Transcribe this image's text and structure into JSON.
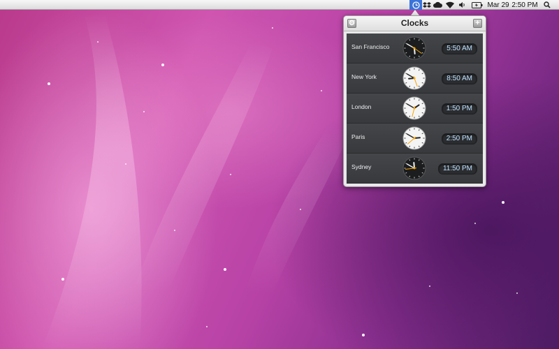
{
  "menubar": {
    "date": "Mar 29",
    "time": "2:50 PM",
    "icons": [
      "clock-icon",
      "dropbox-icon",
      "cloud-icon",
      "wifi-icon",
      "volume-icon",
      "battery-icon",
      "spotlight-search-icon"
    ]
  },
  "popover": {
    "title": "Clocks",
    "gear_label": "⚙",
    "add_label": "+",
    "clocks": [
      {
        "city": "San Francisco",
        "time": "5:50 AM",
        "hour": 5,
        "minute": 50,
        "face": "dark"
      },
      {
        "city": "New York",
        "time": "8:50 AM",
        "hour": 8,
        "minute": 50,
        "face": "light"
      },
      {
        "city": "London",
        "time": "1:50 PM",
        "hour": 1,
        "minute": 50,
        "face": "light"
      },
      {
        "city": "Paris",
        "time": "2:50 PM",
        "hour": 2,
        "minute": 50,
        "face": "light"
      },
      {
        "city": "Sydney",
        "time": "11:50 PM",
        "hour": 11,
        "minute": 50,
        "face": "dark"
      }
    ]
  },
  "colors": {
    "accent": "#3a73d9",
    "second_hand": "#f5a300",
    "time_text": "#bfe1ff"
  }
}
